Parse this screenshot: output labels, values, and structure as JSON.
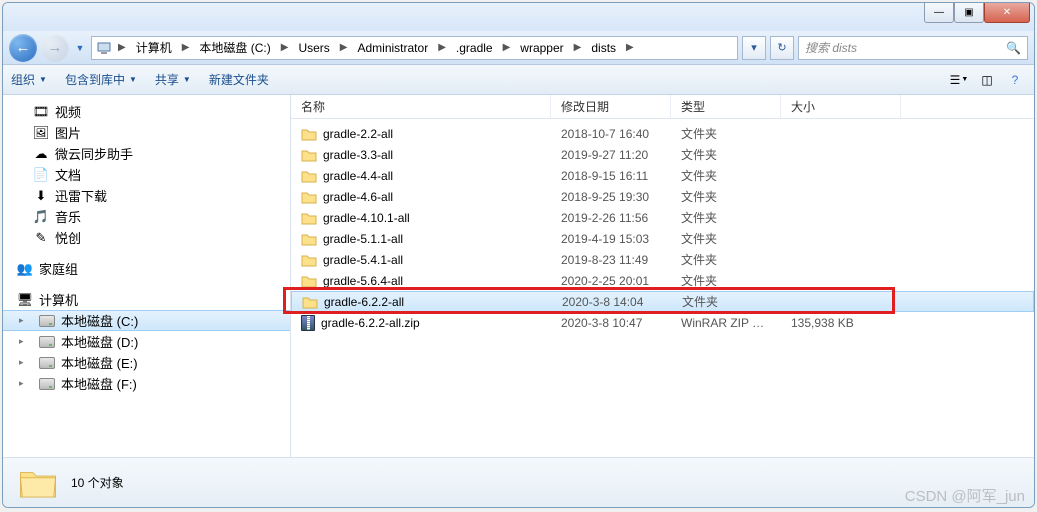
{
  "window_controls": {
    "min": "—",
    "max": "▣",
    "close": "✕"
  },
  "breadcrumb": [
    "计算机",
    "本地磁盘 (C:)",
    "Users",
    "Administrator",
    ".gradle",
    "wrapper",
    "dists"
  ],
  "addr_actions": {
    "dropdown": "▾",
    "refresh": "↻"
  },
  "search": {
    "placeholder": "搜索 dists"
  },
  "toolbar": {
    "organize": "组织",
    "include": "包含到库中",
    "share": "共享",
    "newfolder": "新建文件夹"
  },
  "sidebar": {
    "items": [
      {
        "icon": "video",
        "label": "视频",
        "indent": 30
      },
      {
        "icon": "image",
        "label": "图片",
        "indent": 30
      },
      {
        "icon": "sync",
        "label": "微云同步助手",
        "indent": 30
      },
      {
        "icon": "doc",
        "label": "文档",
        "indent": 30
      },
      {
        "icon": "download",
        "label": "迅雷下载",
        "indent": 30
      },
      {
        "icon": "music",
        "label": "音乐",
        "indent": 30
      },
      {
        "icon": "yuechuang",
        "label": "悦创",
        "indent": 30
      }
    ],
    "homegroup": {
      "icon": "homegroup",
      "label": "家庭组"
    },
    "computer": {
      "label": "计算机",
      "drives": [
        {
          "label": "本地磁盘 (C:)",
          "selected": true
        },
        {
          "label": "本地磁盘 (D:)",
          "selected": false
        },
        {
          "label": "本地磁盘 (E:)",
          "selected": false
        },
        {
          "label": "本地磁盘 (F:)",
          "selected": false
        }
      ]
    }
  },
  "columns": {
    "name": "名称",
    "date": "修改日期",
    "type": "类型",
    "size": "大小"
  },
  "files": [
    {
      "name": "gradle-2.2-all",
      "date": "2018-10-7 16:40",
      "type": "文件夹",
      "size": "",
      "icon": "folder",
      "selected": false
    },
    {
      "name": "gradle-3.3-all",
      "date": "2019-9-27 11:20",
      "type": "文件夹",
      "size": "",
      "icon": "folder",
      "selected": false
    },
    {
      "name": "gradle-4.4-all",
      "date": "2018-9-15 16:11",
      "type": "文件夹",
      "size": "",
      "icon": "folder",
      "selected": false
    },
    {
      "name": "gradle-4.6-all",
      "date": "2018-9-25 19:30",
      "type": "文件夹",
      "size": "",
      "icon": "folder",
      "selected": false
    },
    {
      "name": "gradle-4.10.1-all",
      "date": "2019-2-26 11:56",
      "type": "文件夹",
      "size": "",
      "icon": "folder",
      "selected": false
    },
    {
      "name": "gradle-5.1.1-all",
      "date": "2019-4-19 15:03",
      "type": "文件夹",
      "size": "",
      "icon": "folder",
      "selected": false
    },
    {
      "name": "gradle-5.4.1-all",
      "date": "2019-8-23 11:49",
      "type": "文件夹",
      "size": "",
      "icon": "folder",
      "selected": false
    },
    {
      "name": "gradle-5.6.4-all",
      "date": "2020-2-25 20:01",
      "type": "文件夹",
      "size": "",
      "icon": "folder",
      "selected": false
    },
    {
      "name": "gradle-6.2.2-all",
      "date": "2020-3-8 14:04",
      "type": "文件夹",
      "size": "",
      "icon": "folder",
      "selected": true
    },
    {
      "name": "gradle-6.2.2-all.zip",
      "date": "2020-3-8 10:47",
      "type": "WinRAR ZIP 压缩...",
      "size": "135,938 KB",
      "icon": "zip",
      "selected": false
    }
  ],
  "status": {
    "count_label": "10 个对象"
  },
  "watermark": "CSDN @阿军_jun",
  "highlight_row_index": 8
}
